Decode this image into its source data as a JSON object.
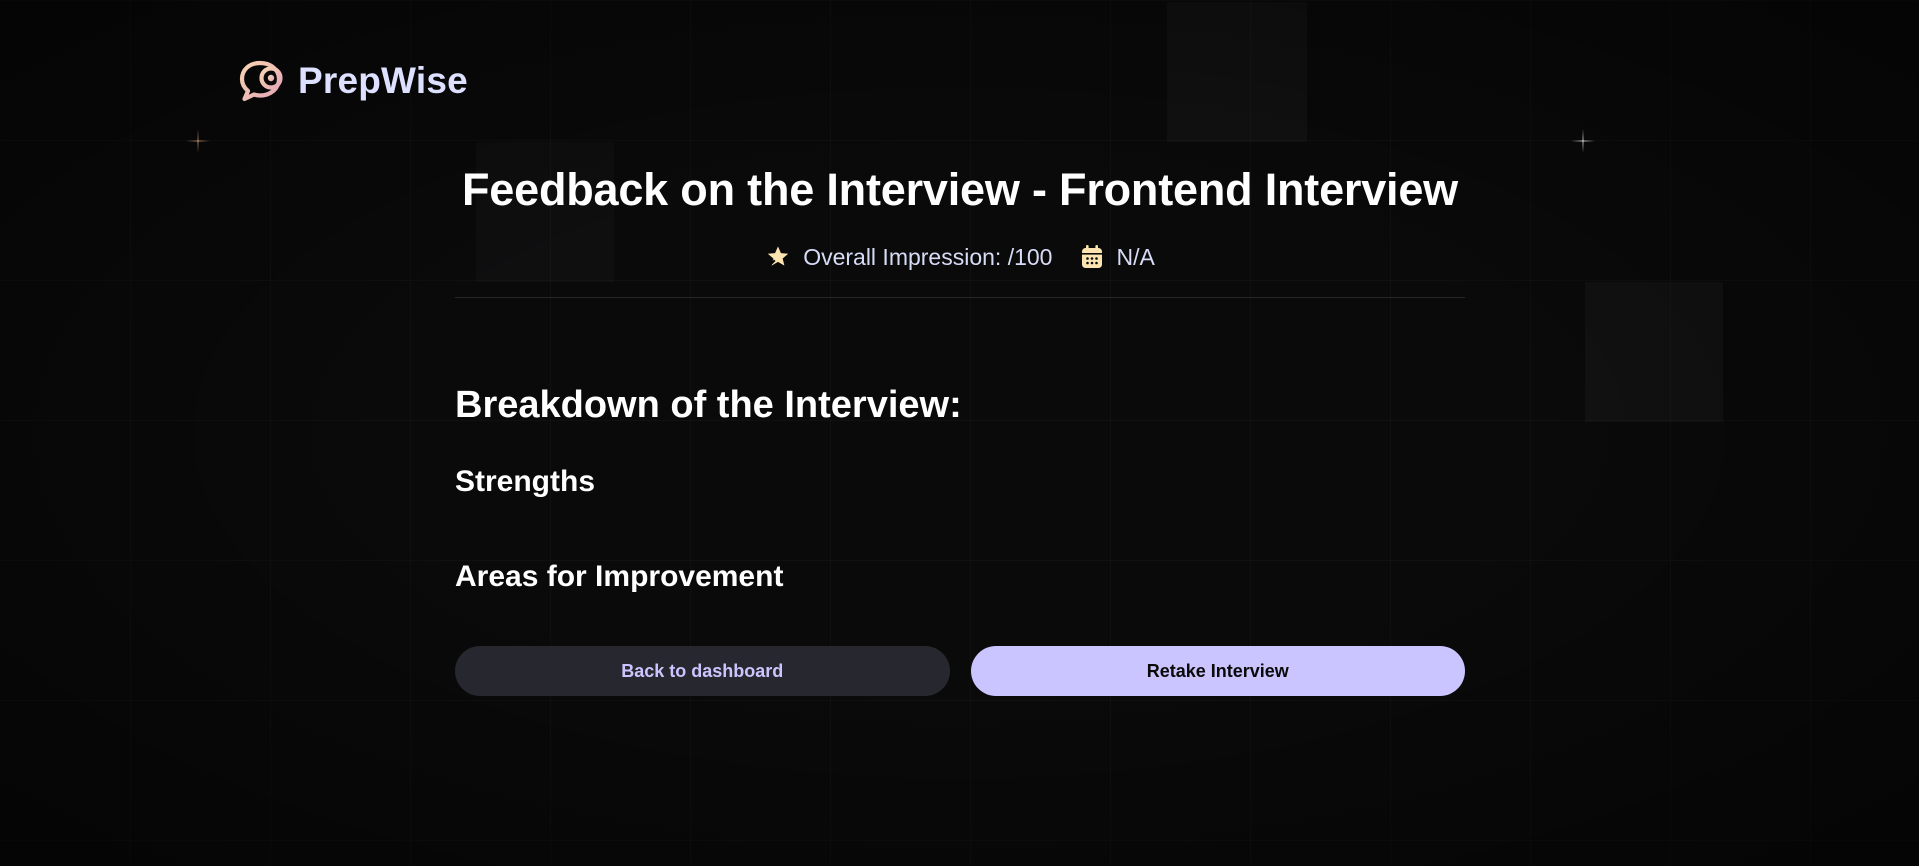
{
  "brand": {
    "name": "PrepWise"
  },
  "feedback": {
    "title": "Feedback on the Interview - Frontend Interview",
    "overall_impression": "Overall Impression: /100",
    "date": "N/A"
  },
  "breakdown": {
    "title": "Breakdown of the Interview:",
    "strengths_title": "Strengths",
    "improvement_title": "Areas for Improvement"
  },
  "actions": {
    "back_label": "Back to dashboard",
    "retake_label": "Retake Interview"
  },
  "icons": {
    "logo": "chat-bubble-logo-icon",
    "impression": "star-icon",
    "date": "calendar-icon"
  },
  "colors": {
    "background": "#0a0a0b",
    "accent": "#cac5fe",
    "secondary_button": "#27282f",
    "logo_gradient_start": "#f5c9a8",
    "logo_gradient_end": "#e4a7b8",
    "brand_text": "#dde0ff",
    "meta_text": "#d6dcf5",
    "icon_fill": "#fbe4b0"
  }
}
